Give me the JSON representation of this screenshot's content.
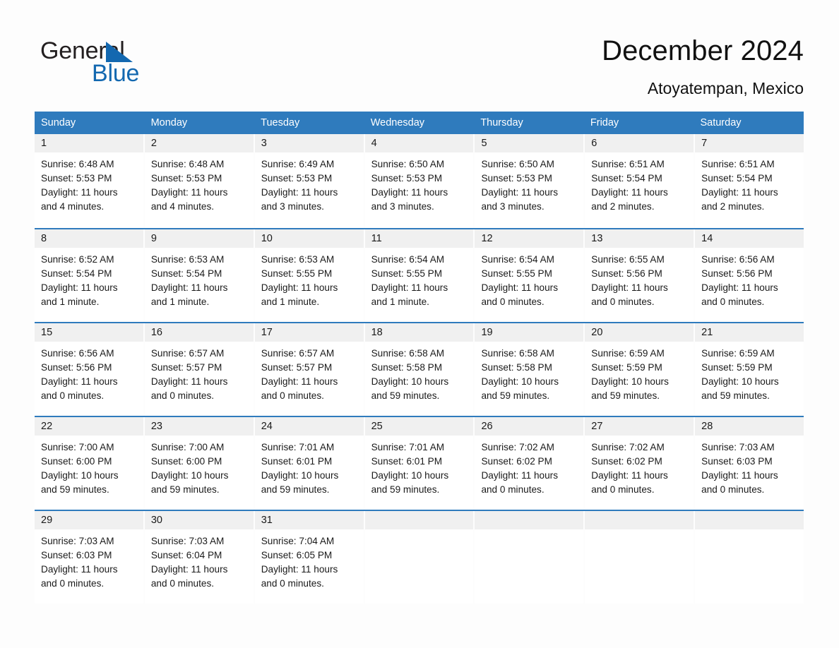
{
  "brand": {
    "name_part1": "General",
    "name_part2": "Blue",
    "triangle_icon": "triangle-icon",
    "accent_color": "#1368b0"
  },
  "header": {
    "title": "December 2024",
    "subtitle": "Atoyatempan, Mexico"
  },
  "theme": {
    "header_blue": "#2f7bbd",
    "daynum_band": "#f0f0f0",
    "page_background": "#fdfdfd",
    "text_color": "#1a1a1a"
  },
  "weekdays": [
    "Sunday",
    "Monday",
    "Tuesday",
    "Wednesday",
    "Thursday",
    "Friday",
    "Saturday"
  ],
  "weeks": [
    [
      {
        "day": "1",
        "sunrise": "Sunrise: 6:48 AM",
        "sunset": "Sunset: 5:53 PM",
        "daylight_line1": "Daylight: 11 hours",
        "daylight_line2": "and 4 minutes."
      },
      {
        "day": "2",
        "sunrise": "Sunrise: 6:48 AM",
        "sunset": "Sunset: 5:53 PM",
        "daylight_line1": "Daylight: 11 hours",
        "daylight_line2": "and 4 minutes."
      },
      {
        "day": "3",
        "sunrise": "Sunrise: 6:49 AM",
        "sunset": "Sunset: 5:53 PM",
        "daylight_line1": "Daylight: 11 hours",
        "daylight_line2": "and 3 minutes."
      },
      {
        "day": "4",
        "sunrise": "Sunrise: 6:50 AM",
        "sunset": "Sunset: 5:53 PM",
        "daylight_line1": "Daylight: 11 hours",
        "daylight_line2": "and 3 minutes."
      },
      {
        "day": "5",
        "sunrise": "Sunrise: 6:50 AM",
        "sunset": "Sunset: 5:53 PM",
        "daylight_line1": "Daylight: 11 hours",
        "daylight_line2": "and 3 minutes."
      },
      {
        "day": "6",
        "sunrise": "Sunrise: 6:51 AM",
        "sunset": "Sunset: 5:54 PM",
        "daylight_line1": "Daylight: 11 hours",
        "daylight_line2": "and 2 minutes."
      },
      {
        "day": "7",
        "sunrise": "Sunrise: 6:51 AM",
        "sunset": "Sunset: 5:54 PM",
        "daylight_line1": "Daylight: 11 hours",
        "daylight_line2": "and 2 minutes."
      }
    ],
    [
      {
        "day": "8",
        "sunrise": "Sunrise: 6:52 AM",
        "sunset": "Sunset: 5:54 PM",
        "daylight_line1": "Daylight: 11 hours",
        "daylight_line2": "and 1 minute."
      },
      {
        "day": "9",
        "sunrise": "Sunrise: 6:53 AM",
        "sunset": "Sunset: 5:54 PM",
        "daylight_line1": "Daylight: 11 hours",
        "daylight_line2": "and 1 minute."
      },
      {
        "day": "10",
        "sunrise": "Sunrise: 6:53 AM",
        "sunset": "Sunset: 5:55 PM",
        "daylight_line1": "Daylight: 11 hours",
        "daylight_line2": "and 1 minute."
      },
      {
        "day": "11",
        "sunrise": "Sunrise: 6:54 AM",
        "sunset": "Sunset: 5:55 PM",
        "daylight_line1": "Daylight: 11 hours",
        "daylight_line2": "and 1 minute."
      },
      {
        "day": "12",
        "sunrise": "Sunrise: 6:54 AM",
        "sunset": "Sunset: 5:55 PM",
        "daylight_line1": "Daylight: 11 hours",
        "daylight_line2": "and 0 minutes."
      },
      {
        "day": "13",
        "sunrise": "Sunrise: 6:55 AM",
        "sunset": "Sunset: 5:56 PM",
        "daylight_line1": "Daylight: 11 hours",
        "daylight_line2": "and 0 minutes."
      },
      {
        "day": "14",
        "sunrise": "Sunrise: 6:56 AM",
        "sunset": "Sunset: 5:56 PM",
        "daylight_line1": "Daylight: 11 hours",
        "daylight_line2": "and 0 minutes."
      }
    ],
    [
      {
        "day": "15",
        "sunrise": "Sunrise: 6:56 AM",
        "sunset": "Sunset: 5:56 PM",
        "daylight_line1": "Daylight: 11 hours",
        "daylight_line2": "and 0 minutes."
      },
      {
        "day": "16",
        "sunrise": "Sunrise: 6:57 AM",
        "sunset": "Sunset: 5:57 PM",
        "daylight_line1": "Daylight: 11 hours",
        "daylight_line2": "and 0 minutes."
      },
      {
        "day": "17",
        "sunrise": "Sunrise: 6:57 AM",
        "sunset": "Sunset: 5:57 PM",
        "daylight_line1": "Daylight: 11 hours",
        "daylight_line2": "and 0 minutes."
      },
      {
        "day": "18",
        "sunrise": "Sunrise: 6:58 AM",
        "sunset": "Sunset: 5:58 PM",
        "daylight_line1": "Daylight: 10 hours",
        "daylight_line2": "and 59 minutes."
      },
      {
        "day": "19",
        "sunrise": "Sunrise: 6:58 AM",
        "sunset": "Sunset: 5:58 PM",
        "daylight_line1": "Daylight: 10 hours",
        "daylight_line2": "and 59 minutes."
      },
      {
        "day": "20",
        "sunrise": "Sunrise: 6:59 AM",
        "sunset": "Sunset: 5:59 PM",
        "daylight_line1": "Daylight: 10 hours",
        "daylight_line2": "and 59 minutes."
      },
      {
        "day": "21",
        "sunrise": "Sunrise: 6:59 AM",
        "sunset": "Sunset: 5:59 PM",
        "daylight_line1": "Daylight: 10 hours",
        "daylight_line2": "and 59 minutes."
      }
    ],
    [
      {
        "day": "22",
        "sunrise": "Sunrise: 7:00 AM",
        "sunset": "Sunset: 6:00 PM",
        "daylight_line1": "Daylight: 10 hours",
        "daylight_line2": "and 59 minutes."
      },
      {
        "day": "23",
        "sunrise": "Sunrise: 7:00 AM",
        "sunset": "Sunset: 6:00 PM",
        "daylight_line1": "Daylight: 10 hours",
        "daylight_line2": "and 59 minutes."
      },
      {
        "day": "24",
        "sunrise": "Sunrise: 7:01 AM",
        "sunset": "Sunset: 6:01 PM",
        "daylight_line1": "Daylight: 10 hours",
        "daylight_line2": "and 59 minutes."
      },
      {
        "day": "25",
        "sunrise": "Sunrise: 7:01 AM",
        "sunset": "Sunset: 6:01 PM",
        "daylight_line1": "Daylight: 10 hours",
        "daylight_line2": "and 59 minutes."
      },
      {
        "day": "26",
        "sunrise": "Sunrise: 7:02 AM",
        "sunset": "Sunset: 6:02 PM",
        "daylight_line1": "Daylight: 11 hours",
        "daylight_line2": "and 0 minutes."
      },
      {
        "day": "27",
        "sunrise": "Sunrise: 7:02 AM",
        "sunset": "Sunset: 6:02 PM",
        "daylight_line1": "Daylight: 11 hours",
        "daylight_line2": "and 0 minutes."
      },
      {
        "day": "28",
        "sunrise": "Sunrise: 7:03 AM",
        "sunset": "Sunset: 6:03 PM",
        "daylight_line1": "Daylight: 11 hours",
        "daylight_line2": "and 0 minutes."
      }
    ],
    [
      {
        "day": "29",
        "sunrise": "Sunrise: 7:03 AM",
        "sunset": "Sunset: 6:03 PM",
        "daylight_line1": "Daylight: 11 hours",
        "daylight_line2": "and 0 minutes."
      },
      {
        "day": "30",
        "sunrise": "Sunrise: 7:03 AM",
        "sunset": "Sunset: 6:04 PM",
        "daylight_line1": "Daylight: 11 hours",
        "daylight_line2": "and 0 minutes."
      },
      {
        "day": "31",
        "sunrise": "Sunrise: 7:04 AM",
        "sunset": "Sunset: 6:05 PM",
        "daylight_line1": "Daylight: 11 hours",
        "daylight_line2": "and 0 minutes."
      },
      {
        "day": "",
        "sunrise": "",
        "sunset": "",
        "daylight_line1": "",
        "daylight_line2": ""
      },
      {
        "day": "",
        "sunrise": "",
        "sunset": "",
        "daylight_line1": "",
        "daylight_line2": ""
      },
      {
        "day": "",
        "sunrise": "",
        "sunset": "",
        "daylight_line1": "",
        "daylight_line2": ""
      },
      {
        "day": "",
        "sunrise": "",
        "sunset": "",
        "daylight_line1": "",
        "daylight_line2": ""
      }
    ]
  ]
}
